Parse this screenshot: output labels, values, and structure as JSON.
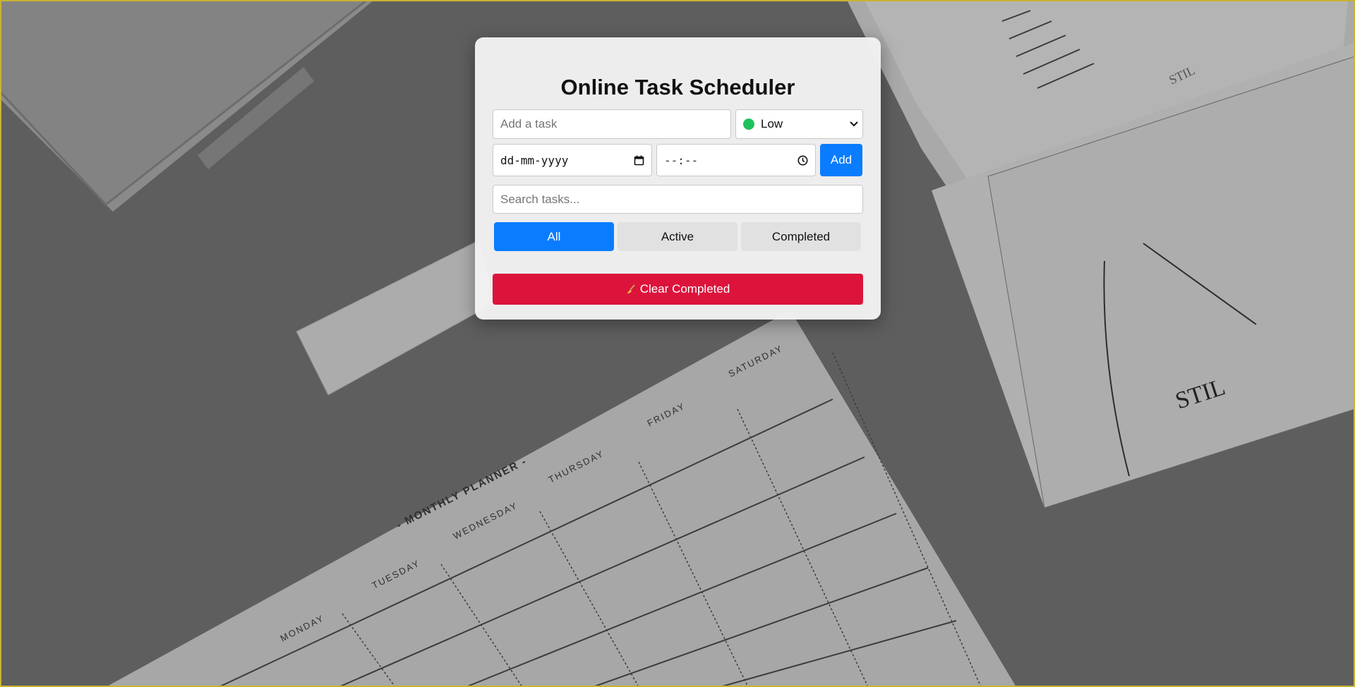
{
  "app": {
    "title": "Online Task Scheduler"
  },
  "form": {
    "task_placeholder": "Add a task",
    "priority_selected": "Low",
    "priority_color": "#1fc25a",
    "date_placeholder": "dd-mm-yyyy",
    "time_placeholder": "--:--",
    "add_label": "Add"
  },
  "search": {
    "placeholder": "Search tasks..."
  },
  "filters": [
    {
      "label": "All",
      "active": true
    },
    {
      "label": "Active",
      "active": false
    },
    {
      "label": "Completed",
      "active": false
    }
  ],
  "actions": {
    "clear_completed_label": "Clear Completed",
    "clear_icon": "broom-icon"
  },
  "colors": {
    "accent": "#0a7cff",
    "danger": "#dc143c",
    "low_priority": "#1fc25a"
  }
}
